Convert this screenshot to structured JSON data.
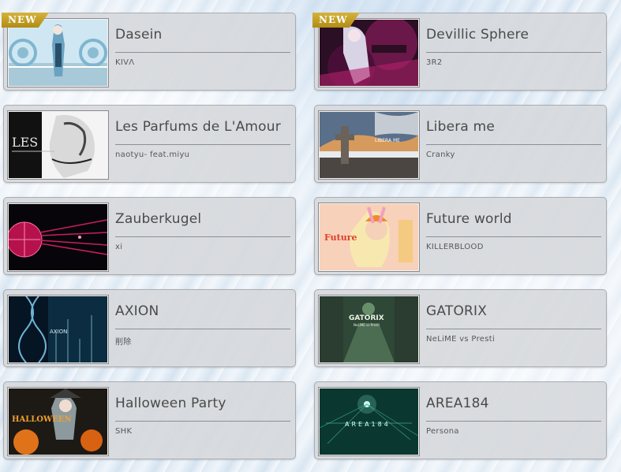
{
  "songs": [
    {
      "title": "Dasein",
      "artist": "KIVΛ",
      "badge": "NEW",
      "thumb": "dasein-jacket"
    },
    {
      "title": "Devillic Sphere",
      "artist": "3R2",
      "badge": "NEW",
      "thumb": "devillic-sphere-jacket"
    },
    {
      "title": "Les Parfums de L'Amour",
      "artist": "naotyu- feat.miyu",
      "badge": "",
      "thumb": "les-parfums-jacket"
    },
    {
      "title": "Libera me",
      "artist": "Cranky",
      "badge": "",
      "thumb": "libera-me-jacket"
    },
    {
      "title": "Zauberkugel",
      "artist": "xi",
      "badge": "",
      "thumb": "zauberkugel-jacket"
    },
    {
      "title": "Future world",
      "artist": "KILLERBLOOD",
      "badge": "",
      "thumb": "future-world-jacket"
    },
    {
      "title": "AXION",
      "artist": "削除",
      "badge": "",
      "thumb": "axion-jacket"
    },
    {
      "title": "GATORIX",
      "artist": "NeLiME vs Presti",
      "badge": "",
      "thumb": "gatorix-jacket"
    },
    {
      "title": "Halloween Party",
      "artist": "SHK",
      "badge": "",
      "thumb": "halloween-party-jacket"
    },
    {
      "title": "AREA184",
      "artist": "Persona",
      "badge": "",
      "thumb": "area184-jacket"
    }
  ],
  "jacket_text": {
    "les_parfums": "LES",
    "libera_me": "LIBERA ME",
    "future_world": "Future",
    "axion": "AXION",
    "gatorix": "GATORIX",
    "gatorix_sub": "NeLiME vs Presti",
    "halloween": "HALLOWEEN",
    "area184": "AREA184"
  }
}
